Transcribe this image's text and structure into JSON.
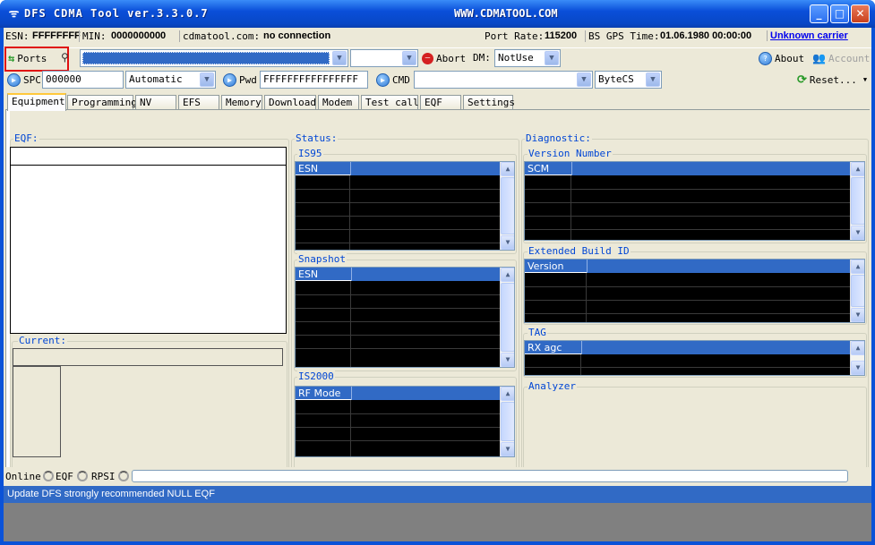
{
  "window": {
    "title": "DFS CDMA Tool ver.3.3.0.7",
    "site": "WWW.CDMATOOL.COM",
    "min_symbol": "_",
    "max_symbol": "□",
    "close_symbol": "✕"
  },
  "infobar": {
    "esn_label": "ESN:",
    "esn_value": "FFFFFFFF",
    "min_label": "MIN:",
    "min_value": "0000000000",
    "site_label": "cdmatool.com:",
    "connection": "no connection",
    "port_rate_label": "Port Rate:",
    "port_rate_value": "115200",
    "gps_label": "BS GPS Time:",
    "gps_value": "01.06.1980 00:00:00",
    "carrier": "Unknown carrier"
  },
  "toolbar": {
    "ports_label": "Ports",
    "abort_label": "Abort",
    "dm_label": "DM:",
    "dm_value": "NotUse",
    "about_label": "About",
    "account_label": "Account"
  },
  "toolbar2": {
    "spc_label": "SPC",
    "spc_value": "000000",
    "mode_value": "Automatic",
    "pwd_label": "Pwd",
    "pwd_value": "FFFFFFFFFFFFFFFF",
    "cmd_label": "CMD",
    "cmd_value": "",
    "format_value": "ByteCS",
    "reset_label": "Reset..."
  },
  "tabs": [
    "Equipment",
    "Programming",
    "NV",
    "EFS",
    "Memory",
    "Download",
    "Modem",
    "Test call",
    "EQF",
    "Settings"
  ],
  "eqf": {
    "group_label": "EQF:",
    "current_label": "Current:"
  },
  "status": {
    "group_label": "Status:",
    "is95_label": "IS95",
    "is95_header": "ESN",
    "snapshot_label": "Snapshot",
    "snapshot_header": "ESN",
    "is2000_label": "IS2000",
    "is2000_header": "RF Mode"
  },
  "diagnostic": {
    "group_label": "Diagnostic:",
    "version_label": "Version Number",
    "version_header": "SCM",
    "ext_build_label": "Extended Build ID",
    "ext_build_header": "Version",
    "tag_label": "TAG",
    "tag_header": "RX agc",
    "analyzer_label": "Analyzer"
  },
  "statusbar": {
    "online_label": "Online",
    "eqf_label": "EQF",
    "rpsi_label": "RPSI"
  },
  "message": "Update DFS strongly recommended  NULL EQF",
  "colors": {
    "title_blue": "#0a52d8",
    "header_blue": "#316ac5",
    "group_label_blue": "#0046d5",
    "highlight_red": "#e01010",
    "panel_beige": "#ece9d8"
  }
}
